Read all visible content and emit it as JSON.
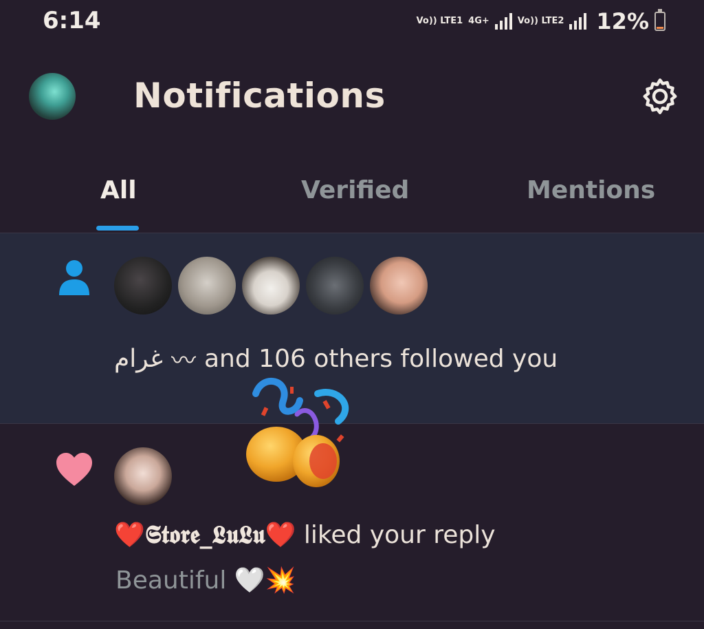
{
  "status_bar": {
    "time": "6:14",
    "sim1": "Vo)) LTE1",
    "network": "4G+",
    "sim2": "Vo)) LTE2",
    "battery": "12%",
    "battery_level": 0.12,
    "battery_color": "#f08a4b"
  },
  "header": {
    "title": "Notifications",
    "settings_icon": "gear-icon",
    "avatar_icon": "avatar"
  },
  "tabs": [
    {
      "label": "All",
      "selected": true
    },
    {
      "label": "Verified",
      "selected": false
    },
    {
      "label": "Mentions",
      "selected": false
    }
  ],
  "accent_color": "#2a9ee8",
  "notifications": {
    "follow": {
      "icon": "person-icon",
      "name": "غرام",
      "name_symbol": "〰",
      "text": "and 106 others followed you",
      "avatar_count": 5,
      "sticker": "party-popper"
    },
    "like": {
      "icon": "heart-icon",
      "heart_color": "#f58aa0",
      "user_prefix": "❤️",
      "user_name": "𝕾𝖙𝖔𝖗𝖊_𝕷𝖚𝕷𝖚",
      "user_suffix": "❤️",
      "text": "liked your reply",
      "reply": "Beautiful 🤍💥"
    }
  }
}
